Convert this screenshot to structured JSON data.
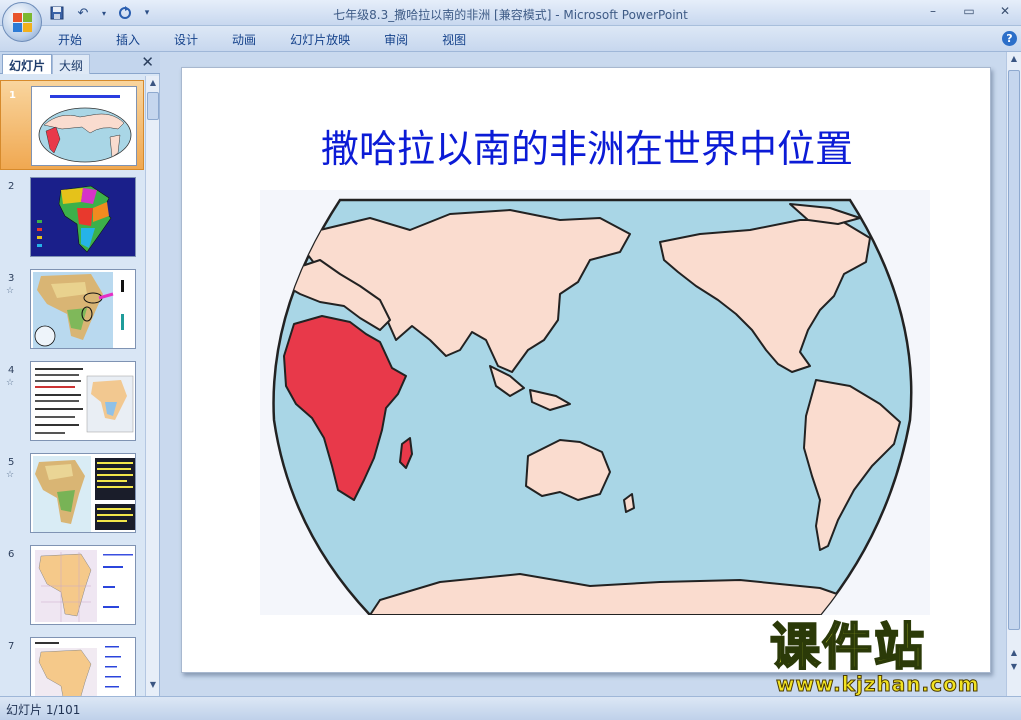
{
  "window": {
    "title": "七年级8.3_撒哈拉以南的非洲 [兼容模式] - Microsoft PowerPoint",
    "controls": [
      "–",
      "▭",
      "✕"
    ]
  },
  "ribbon": {
    "tabs": [
      "开始",
      "插入",
      "设计",
      "动画",
      "幻灯片放映",
      "审阅",
      "视图"
    ],
    "help": "?"
  },
  "slide_pane": {
    "tab_slides": "幻灯片",
    "tab_outline": "大纲",
    "close": "✕",
    "thumbnails": [
      {
        "num": "1",
        "star": ""
      },
      {
        "num": "2",
        "star": ""
      },
      {
        "num": "3",
        "star": "☆"
      },
      {
        "num": "4",
        "star": "☆"
      },
      {
        "num": "5",
        "star": "☆"
      },
      {
        "num": "6",
        "star": ""
      },
      {
        "num": "7",
        "star": ""
      }
    ]
  },
  "slide": {
    "title": "撒哈拉以南的非洲在世界中位置"
  },
  "colors": {
    "ocean": "#a9d6e6",
    "land": "#fadccf",
    "africa": "#e8394a",
    "title": "#0b1bd6"
  },
  "watermark": {
    "cn": "课件站",
    "url": "www.kjzhan.com"
  },
  "status": {
    "slide_counter": "幻灯片 1/101"
  }
}
